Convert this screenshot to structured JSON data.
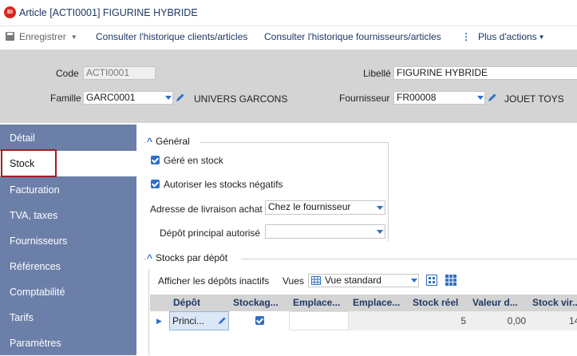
{
  "window": {
    "app_icon": "BI",
    "title": "Article [ACTI0001] FIGURINE HYBRIDE"
  },
  "toolbar": {
    "save_label": "Enregistrer",
    "history_clients": "Consulter l'historique clients/articles",
    "history_suppliers": "Consulter l'historique fournisseurs/articles",
    "more_actions": "Plus d'actions"
  },
  "header": {
    "code_label": "Code",
    "code_value": "ACTI0001",
    "libelle_label": "Libellé",
    "libelle_value": "FIGURINE HYBRIDE",
    "famille_label": "Famille",
    "famille_value": "GARC0001",
    "famille_desc": "UNIVERS GARCONS",
    "fournisseur_label": "Fournisseur",
    "fournisseur_value": "FR00008",
    "fournisseur_desc": "JOUET TOYS"
  },
  "sidebar": {
    "items": [
      {
        "label": "Détail"
      },
      {
        "label": "Stock"
      },
      {
        "label": "Facturation"
      },
      {
        "label": "TVA, taxes"
      },
      {
        "label": "Fournisseurs"
      },
      {
        "label": "Références"
      },
      {
        "label": "Comptabilité"
      },
      {
        "label": "Tarifs"
      },
      {
        "label": "Paramètres"
      }
    ],
    "active": "Stock"
  },
  "general": {
    "title": "Général",
    "gere_en_stock": "Géré en stock",
    "autoriser_negatifs": "Autoriser les stocks négatifs",
    "adresse_label": "Adresse de livraison achat",
    "adresse_value": "Chez le fournisseur",
    "depot_label": "Dépôt principal autorisé",
    "depot_value": ""
  },
  "stocks": {
    "title": "Stocks par dépôt",
    "show_inactive": "Afficher les dépôts inactifs",
    "vues_label": "Vues",
    "vues_value": "Vue standard",
    "columns": [
      "Dépôt",
      "Stockag...",
      "Emplace...",
      "Emplace...",
      "Stock réel",
      "Valeur d...",
      "Stock vir..."
    ],
    "row": {
      "depot": "Princi...",
      "stock_reel": "5",
      "valeur": "0,00",
      "stock_virtuel": "14"
    }
  },
  "colors": {
    "accent": "#2f6fc4",
    "sidebar": "#6b7fa8",
    "header_bg": "#d4d4d4",
    "title_text": "#1f3864",
    "highlight": "#a31f1f"
  }
}
